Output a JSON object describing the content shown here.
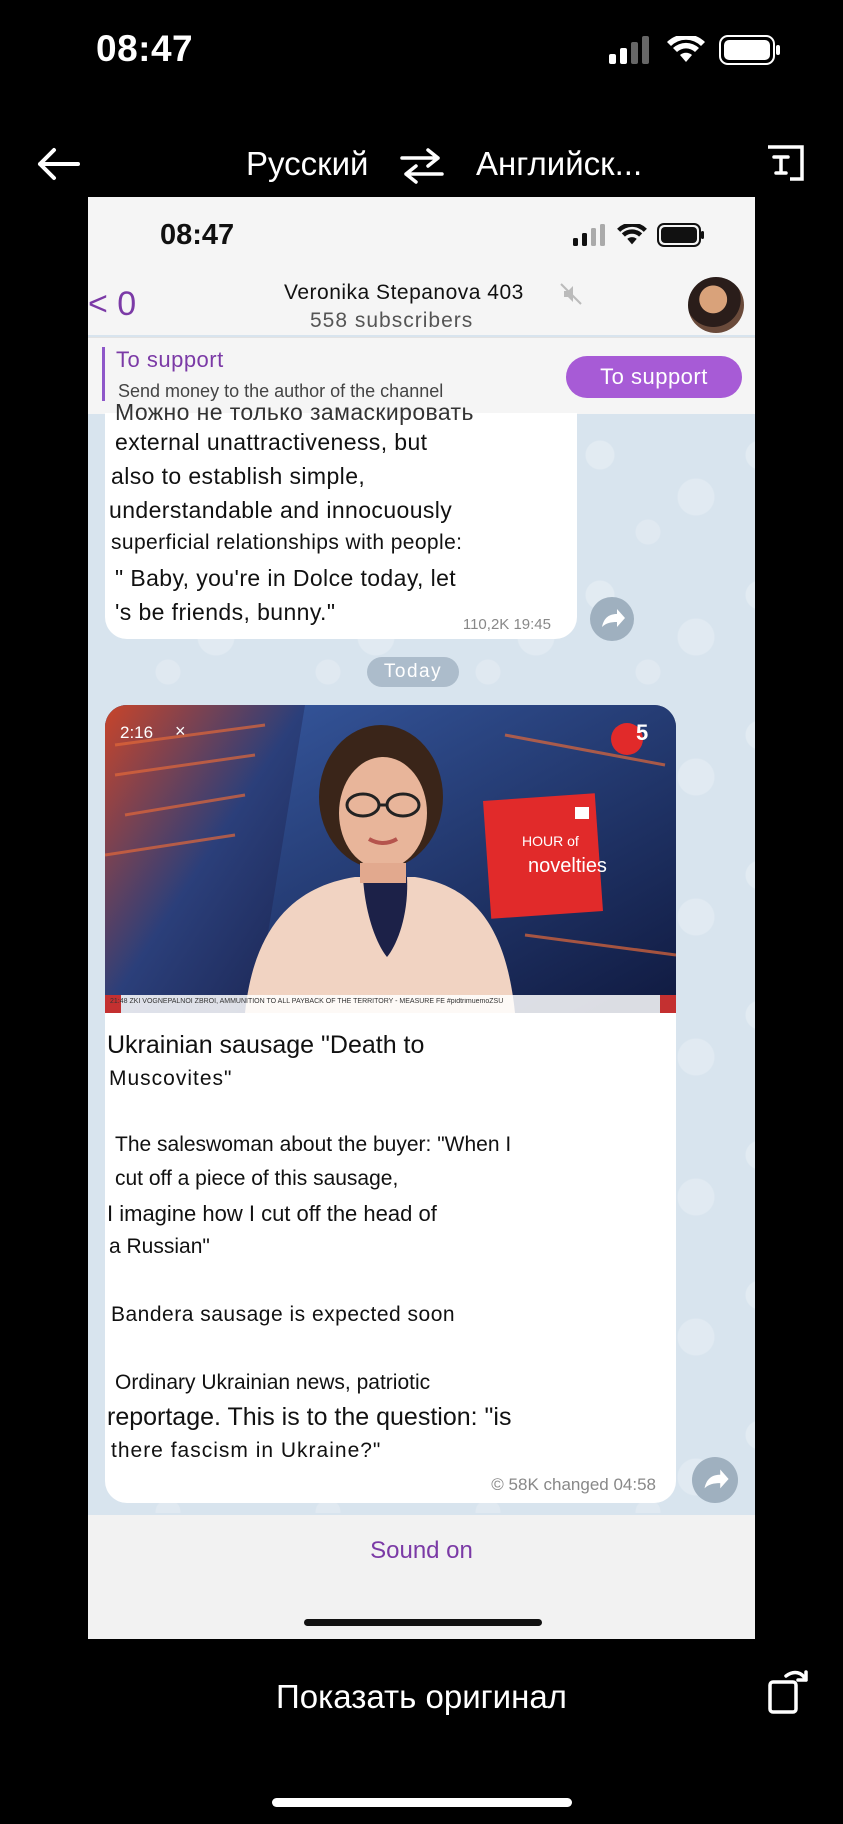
{
  "os": {
    "time": "08:47"
  },
  "translator": {
    "source_lang": "Русский",
    "target_lang": "Английск...",
    "show_original": "Показать оригинал"
  },
  "inner": {
    "time": "08:47",
    "back_count": "< 0",
    "channel_name": "Veronika  Stepanova  403",
    "subscribers": "558  subscribers",
    "pin_title": "To  support",
    "pin_text": "Send money to the author of the channel",
    "support_button": "To  support"
  },
  "message1": {
    "lines": [
      "Можно не только замаскировать",
      "external  unattractiveness,  but",
      "also  to  establish  simple,",
      "understandable  and  innocuously",
      "superficial  relationships  with  people:",
      "\" Baby, you're in Dolce today, let",
      "'s be friends, bunny.\""
    ],
    "meta": "110,2K  19:45"
  },
  "date_separator": "Today",
  "message2": {
    "video_duration": "2:16",
    "video_close": "×",
    "video_overlay_hour": "HOUR of",
    "video_overlay_novelties": "novelties",
    "video_ticker": "21:48  ZKI  VOGNEPALNOI  ZBROI,  AMMUNITION  TO  ALL  PAYBACK  OF  THE  TERRITORY  -  MEASURE  FE  #pidtrimuemoZSU",
    "channel_logo": "5",
    "title_line1": "Ukrainian  sausage  \"Death  to",
    "title_line2": "Muscovites\"",
    "para1_line1": "The saleswoman about the buyer: \"When I",
    "para1_line2": "cut  off  a  piece  of  this  sausage,",
    "para1_line3": "I imagine how I cut off the head of",
    "para1_line4": "a  Russian\"",
    "para2": "Bandera  sausage  is  expected  soon",
    "para3_line1": "Ordinary Ukrainian news, patriotic",
    "para3_line2": "reportage. This is to the question: \"is",
    "para3_line3": "there  fascism  in  Ukraine?\"",
    "meta": "© 58K changed 04:58"
  },
  "sound_on": "Sound on",
  "colors": {
    "accent": "#7b3aa6",
    "support_button": "#a75bd6",
    "chat_bg": "#d8e4ee"
  }
}
